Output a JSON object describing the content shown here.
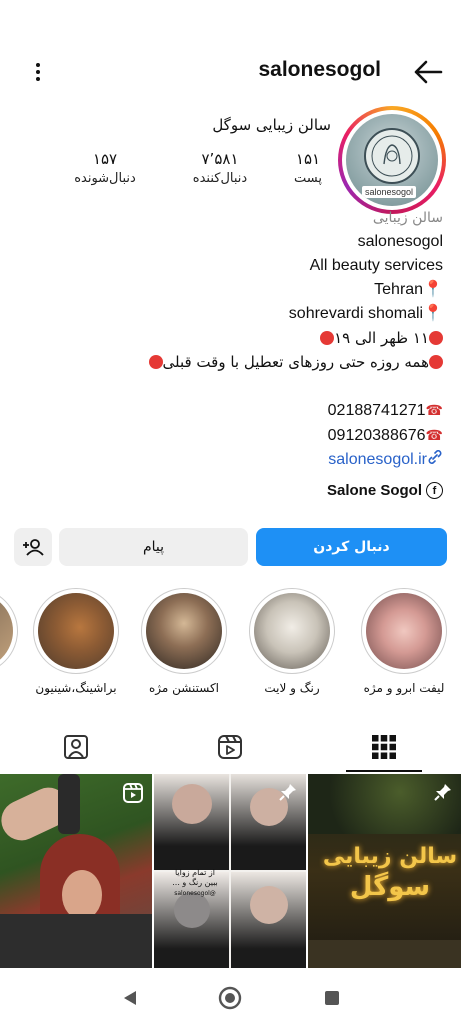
{
  "header": {
    "username": "salonesogol"
  },
  "profile": {
    "display_name": "سالن زیبایی سوگل",
    "avatar_tag": "salonesogol",
    "stats": [
      {
        "value": "۱۵۱",
        "label": "پست"
      },
      {
        "value": "۷٬۵۸۱",
        "label": "دنبال‌کننده"
      },
      {
        "value": "۱۵۷",
        "label": "دنبال‌شونده"
      }
    ]
  },
  "bio": {
    "category": "سالن زیبایی",
    "handle": "salonesogol",
    "tagline": "All beauty services",
    "city": "Tehran",
    "street": "sohrevardi shomali",
    "hours": "۱۱ ظهر الی ۱۹",
    "note": "همه روزه حتی روزهای تعطیل با وقت قبلی",
    "phone1": "02188741271",
    "phone2": "09120388676",
    "website": "salonesogol.ir",
    "facebook": "Salone Sogol"
  },
  "actions": {
    "follow_label": "دنبال کردن",
    "message_label": "پیام"
  },
  "highlights": [
    {
      "label": "لیفت ابرو و مژه"
    },
    {
      "label": "رنگ و لایت"
    },
    {
      "label": "اکستنشن مژه"
    },
    {
      "label": "براشینگ،شینیون"
    }
  ],
  "posts": {
    "caption_line1": "از تمام زوایا",
    "caption_line2": "ببین رنگ و ...",
    "caption_tag": "@salonesogol",
    "sign_line1": "سالن زیبایی",
    "sign_line2": "سوگل"
  },
  "colors": {
    "accent": "#1e90f5",
    "link": "#2962c9",
    "red": "#e53935"
  }
}
